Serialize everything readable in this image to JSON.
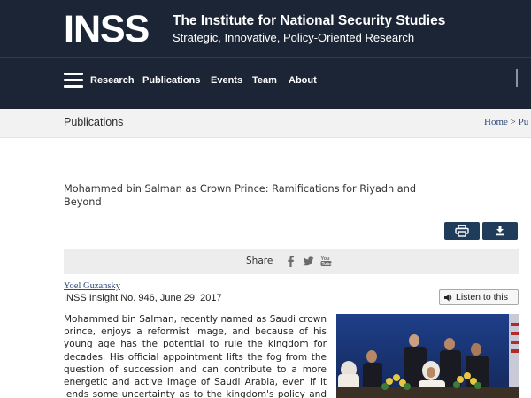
{
  "header": {
    "logo_text": "INSS",
    "title": "The Institute for National Security Studies",
    "subtitle": "Strategic, Innovative, Policy-Oriented Research",
    "nav": [
      "Research",
      "Publications",
      "Events",
      "Team",
      "About"
    ],
    "colors": {
      "background": "#1c2535",
      "text": "#ffffff"
    }
  },
  "breadcrumb": {
    "section": "Publications",
    "home": "Home",
    "separator": ">",
    "next": "Pu"
  },
  "article": {
    "title": "Mohammed bin Salman as Crown Prince: Ramifications for Riyadh and Beyond",
    "tools": {
      "print_icon": "printer-icon",
      "download_icon": "download-icon",
      "color": "#1f3d5a"
    },
    "share": {
      "label": "Share",
      "icons": [
        "facebook-icon",
        "twitter-icon",
        "youtube-icon"
      ]
    },
    "author": "Yoel Guzansky",
    "meta": "INSS Insight No. 946, June 29, 2017",
    "listen_label": "Listen to this",
    "body": "Mohammed bin Salman, recently named as Saudi crown prince, enjoys a reformist image, and because of his young age has the potential to rule the kingdom for decades. His official appointment lifts the fog from the question of succession and can contribute to a more energetic and active image of Saudi Arabia, even if it lends some uncertainty as to the kingdom's policy and ability to meet"
  }
}
